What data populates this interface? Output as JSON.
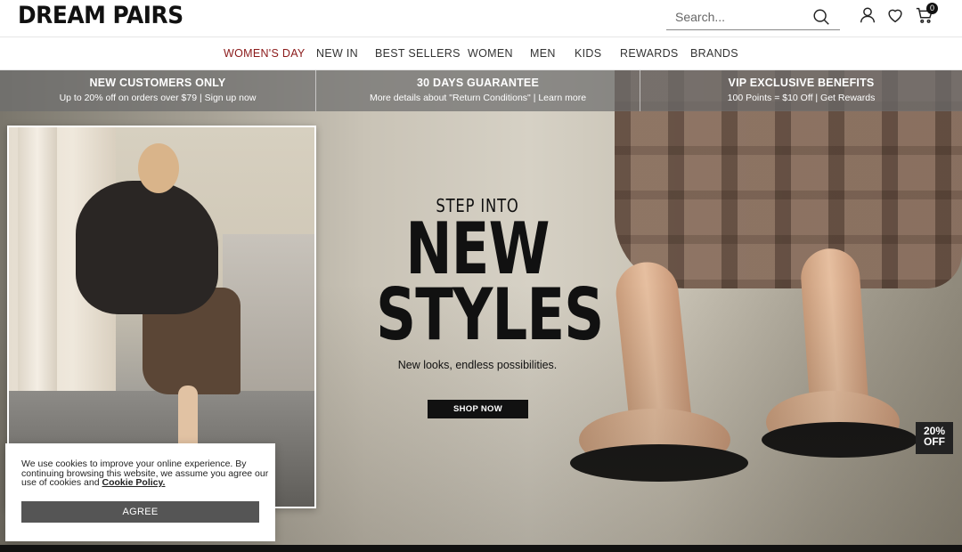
{
  "header": {
    "logo": "DREAM PAIRS",
    "search_placeholder": "Search...",
    "cart_count": "0"
  },
  "nav": {
    "items": [
      {
        "label": "WOMEN'S DAY",
        "active": true
      },
      {
        "label": "NEW IN"
      },
      {
        "label": "BEST SELLERS"
      },
      {
        "label": "WOMEN"
      },
      {
        "label": "MEN"
      },
      {
        "label": "KIDS"
      },
      {
        "label": "REWARDS"
      },
      {
        "label": "BRANDS"
      }
    ],
    "active_color": "#8b1a1a"
  },
  "promo": [
    {
      "title": "NEW CUSTOMERS ONLY",
      "sub": "Up to 20% off on orders over $79 | Sign up now"
    },
    {
      "title": "30 DAYS GUARANTEE",
      "sub": "More details about \"Return Conditions\" | Learn more"
    },
    {
      "title": "VIP EXCLUSIVE BENEFITS",
      "sub": "100 Points = $10 Off | Get Rewards"
    }
  ],
  "hero": {
    "kicker": "STEP INTO",
    "line1": "NEW",
    "line2": "STYLES",
    "tagline": "New looks, endless possibilities.",
    "cta": "SHOP NOW",
    "badge_line1": "20%",
    "badge_line2": "OFF"
  },
  "cookie": {
    "text": "We use cookies to improve your online experience. By continuing browsing this website, we assume you agree our use of cookies and ",
    "link": "Cookie Policy.",
    "button": "AGREE"
  },
  "icons": {
    "search": "search-icon",
    "account": "user-icon",
    "wishlist": "heart-icon",
    "cart": "cart-icon"
  }
}
